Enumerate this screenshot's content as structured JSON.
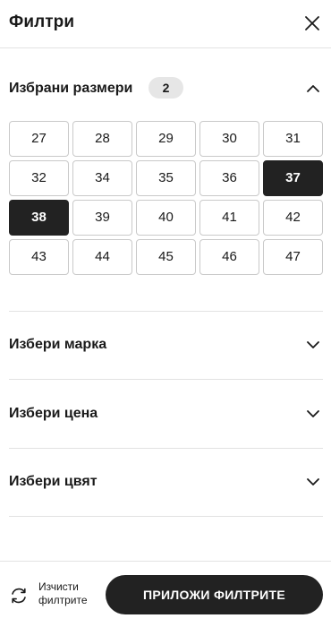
{
  "header": {
    "title": "Филтри",
    "close_icon": "close-icon"
  },
  "sizes_section": {
    "label": "Избрани размери",
    "selected_count": "2",
    "expanded": true,
    "options": [
      "27",
      "28",
      "29",
      "30",
      "31",
      "32",
      "34",
      "35",
      "36",
      "37",
      "38",
      "39",
      "40",
      "41",
      "42",
      "43",
      "44",
      "45",
      "46",
      "47"
    ],
    "selected": [
      "37",
      "38"
    ]
  },
  "sections": [
    {
      "label": "Избери марка",
      "expanded": false
    },
    {
      "label": "Избери цена",
      "expanded": false
    },
    {
      "label": "Избери цвят",
      "expanded": false
    }
  ],
  "footer": {
    "clear_label_line1": "Изчисти",
    "clear_label_line2": "филтрите",
    "clear_icon": "refresh-icon",
    "apply_label": "ПРИЛОЖИ ФИЛТРИТЕ"
  },
  "colors": {
    "selected_bg": "#222222",
    "border": "#c9c9c9",
    "badge_bg": "#e6e6e6"
  }
}
